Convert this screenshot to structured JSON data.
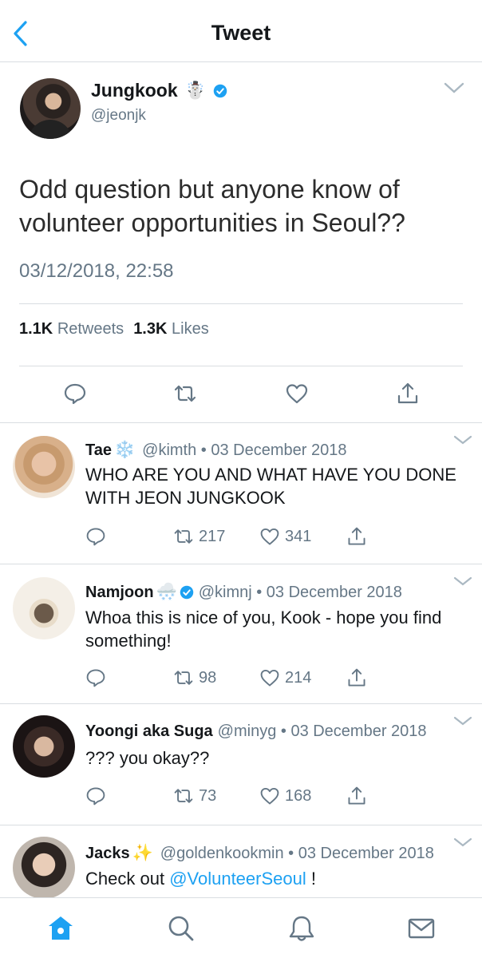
{
  "header": {
    "title": "Tweet"
  },
  "tweet": {
    "name": "Jungkook",
    "name_emoji": "☃️",
    "handle": "@jeonjk",
    "text": "Odd question but anyone know of volunteer opportunities in Seoul??",
    "timestamp": "03/12/2018, 22:58",
    "retweets_count": "1.1K",
    "retweets_label": "Retweets",
    "likes_count": "1.3K",
    "likes_label": "Likes"
  },
  "replies": [
    {
      "name": "Tae",
      "emoji": "❄️",
      "meta": "@kimth • 03 December 2018",
      "text": "WHO ARE YOU AND WHAT HAVE YOU DONE WITH JEON JUNGKOOK",
      "retweets": "217",
      "likes": "341"
    },
    {
      "name": "Namjoon",
      "emoji": "🌨️",
      "meta": "@kimnj • 03 December 2018",
      "text": "Whoa this is nice of you, Kook - hope you find something!",
      "retweets": "98",
      "likes": "214"
    },
    {
      "name": "Yoongi aka Suga",
      "meta": "@minyg • 03 December 2018",
      "text": "??? you okay??",
      "retweets": "73",
      "likes": "168"
    },
    {
      "name": "Jacks",
      "emoji": "✨",
      "meta": "@goldenkookmin • 03 December 2018",
      "text_prefix": "Check out",
      "mention": "@VolunteerSeoul",
      "text_suffix": "!"
    }
  ],
  "colors": {
    "accent": "#1da1f2",
    "secondary_text": "#657786",
    "border": "#d9dde1"
  },
  "icons": {
    "header": [
      "back-chevron-icon"
    ],
    "actions": [
      "reply-icon",
      "retweet-icon",
      "like-icon",
      "share-icon"
    ],
    "tabbar": [
      "home-icon",
      "search-icon",
      "notifications-icon",
      "messages-icon"
    ]
  }
}
